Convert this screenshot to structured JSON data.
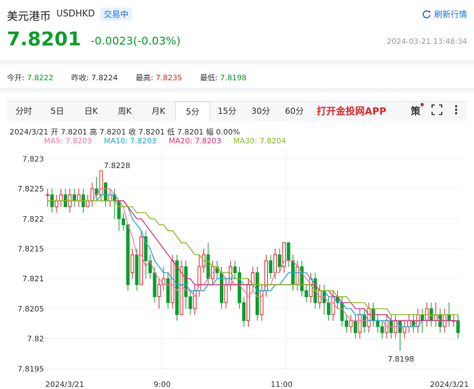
{
  "header": {
    "title": "美元港币",
    "code": "USDHKD",
    "status": "交易中",
    "refresh_label": "刷新行情",
    "price": "7.8201",
    "change": "-0.0023(-0.03%)",
    "timestamp": "2024-03-21 13:48:34"
  },
  "stats": [
    {
      "label": "今开:",
      "value": "7.8222",
      "color": "green"
    },
    {
      "label": "昨收:",
      "value": "7.8224",
      "color": "black"
    },
    {
      "label": "最高:",
      "value": "7.8235",
      "color": "red"
    },
    {
      "label": "最低:",
      "value": "7.8198",
      "color": "green"
    }
  ],
  "tabs": [
    {
      "label": "分时",
      "active": false
    },
    {
      "label": "5日",
      "active": false
    },
    {
      "label": "日K",
      "active": false
    },
    {
      "label": "周K",
      "active": false
    },
    {
      "label": "月K",
      "active": false
    },
    {
      "label": "5分",
      "active": true
    },
    {
      "label": "15分",
      "active": false
    },
    {
      "label": "30分",
      "active": false
    },
    {
      "label": "60分",
      "active": false
    }
  ],
  "toolbar": {
    "app_link": "打开金投网APP",
    "strategy_label": "策"
  },
  "info_line": "2024/3/21  开 7.8201  高 7.8201  收 7.8201  低 7.8201  幅 0.00%",
  "ma_legend": [
    {
      "label": "MA5: 7.8203",
      "color": "#f07aa3"
    },
    {
      "label": "MA10: 7.8203",
      "color": "#1fa9d6"
    },
    {
      "label": "MA20: 7.8203",
      "color": "#e0307a"
    },
    {
      "label": "MA30: 7.8204",
      "color": "#8ab820"
    }
  ],
  "chart_data": {
    "type": "candlestick",
    "x_ticks": [
      "2024/3/21",
      "9:00",
      "11:00",
      "2024/3/21"
    ],
    "y_ticks": [
      7.8195,
      7.82,
      7.8205,
      7.821,
      7.8215,
      7.822,
      7.8225,
      7.823
    ],
    "ylim": [
      7.8194,
      7.8232
    ],
    "annotations": [
      {
        "text": "7.8228",
        "value": 7.8228,
        "at_index": 12
      },
      {
        "text": "7.8198",
        "value": 7.8198,
        "at_index": 79
      }
    ],
    "up_color": "#e0262b",
    "down_color": "#0a9e2c",
    "candles": [
      [
        7.8224,
        7.8224,
        7.8225,
        7.8222
      ],
      [
        7.8224,
        7.8222,
        7.8225,
        7.8221
      ],
      [
        7.8222,
        7.8223,
        7.8224,
        7.8221
      ],
      [
        7.8223,
        7.8224,
        7.8225,
        7.8222
      ],
      [
        7.8224,
        7.8222,
        7.8225,
        7.8222
      ],
      [
        7.8222,
        7.8224,
        7.8225,
        7.8221
      ],
      [
        7.8224,
        7.8223,
        7.8225,
        7.8222
      ],
      [
        7.8223,
        7.8224,
        7.8225,
        7.8222
      ],
      [
        7.8224,
        7.8222,
        7.8225,
        7.8221
      ],
      [
        7.8222,
        7.8223,
        7.8224,
        7.8222
      ],
      [
        7.8223,
        7.8225,
        7.8226,
        7.8222
      ],
      [
        7.8225,
        7.8224,
        7.8227,
        7.8223
      ],
      [
        7.8224,
        7.8228,
        7.8228,
        7.8223
      ],
      [
        7.8226,
        7.8223,
        7.8226,
        7.8222
      ],
      [
        7.8223,
        7.8224,
        7.8225,
        7.8222
      ],
      [
        7.8224,
        7.8223,
        7.8225,
        7.822
      ],
      [
        7.8223,
        7.822,
        7.8223,
        7.8218
      ],
      [
        7.822,
        7.8219,
        7.8221,
        7.8218
      ],
      [
        7.8219,
        7.8209,
        7.8219,
        7.8208
      ],
      [
        7.8211,
        7.8214,
        7.8215,
        7.821
      ],
      [
        7.8214,
        7.8209,
        7.8215,
        7.8208
      ],
      [
        7.8209,
        7.8217,
        7.8218,
        7.8209
      ],
      [
        7.8217,
        7.8213,
        7.8218,
        7.821
      ],
      [
        7.8213,
        7.8211,
        7.8214,
        7.821
      ],
      [
        7.8211,
        7.8207,
        7.8212,
        7.8206
      ],
      [
        7.8207,
        7.8209,
        7.821,
        7.8205
      ],
      [
        7.8209,
        7.821,
        7.8212,
        7.8208
      ],
      [
        7.821,
        7.8206,
        7.8211,
        7.8205
      ],
      [
        7.8206,
        7.8213,
        7.8214,
        7.8205
      ],
      [
        7.8213,
        7.8204,
        7.8214,
        7.8203
      ],
      [
        7.8204,
        7.8212,
        7.8213,
        7.8204
      ],
      [
        7.8212,
        7.8207,
        7.8213,
        7.8205
      ],
      [
        7.8207,
        7.8205,
        7.8208,
        7.8204
      ],
      [
        7.8205,
        7.8208,
        7.8209,
        7.8204
      ],
      [
        7.8208,
        7.8212,
        7.8214,
        7.8207
      ],
      [
        7.8212,
        7.8214,
        7.8215,
        7.8211
      ],
      [
        7.8214,
        7.821,
        7.8216,
        7.8209
      ],
      [
        7.821,
        7.8212,
        7.8213,
        7.8209
      ],
      [
        7.8212,
        7.8211,
        7.8213,
        7.821
      ],
      [
        7.8211,
        7.8206,
        7.8212,
        7.8205
      ],
      [
        7.8206,
        7.8209,
        7.821,
        7.8205
      ],
      [
        7.8209,
        7.8212,
        7.8213,
        7.8208
      ],
      [
        7.8212,
        7.8211,
        7.8213,
        7.821
      ],
      [
        7.8211,
        7.8206,
        7.8212,
        7.8205
      ],
      [
        7.8206,
        7.8203,
        7.8207,
        7.8202
      ],
      [
        7.8203,
        7.8209,
        7.821,
        7.8202
      ],
      [
        7.8209,
        7.8211,
        7.8212,
        7.8208
      ],
      [
        7.8211,
        7.8204,
        7.8212,
        7.8203
      ],
      [
        7.8204,
        7.8208,
        7.8209,
        7.8203
      ],
      [
        7.8208,
        7.8213,
        7.8214,
        7.8207
      ],
      [
        7.8213,
        7.8211,
        7.8214,
        7.821
      ],
      [
        7.8211,
        7.8214,
        7.8215,
        7.821
      ],
      [
        7.8214,
        7.8212,
        7.8215,
        7.8211
      ],
      [
        7.8212,
        7.8216,
        7.8216,
        7.8211
      ],
      [
        7.8216,
        7.8213,
        7.8216,
        7.8212
      ],
      [
        7.8213,
        7.8209,
        7.8214,
        7.8208
      ],
      [
        7.8209,
        7.8212,
        7.8213,
        7.8208
      ],
      [
        7.8212,
        7.8208,
        7.8213,
        7.8207
      ],
      [
        7.8208,
        7.8207,
        7.8209,
        7.8206
      ],
      [
        7.8207,
        7.821,
        7.8211,
        7.8206
      ],
      [
        7.821,
        7.8206,
        7.8211,
        7.8205
      ],
      [
        7.8206,
        7.8208,
        7.8209,
        7.8205
      ],
      [
        7.8208,
        7.8206,
        7.8209,
        7.8204
      ],
      [
        7.8206,
        7.8204,
        7.8207,
        7.8203
      ],
      [
        7.8204,
        7.8207,
        7.8208,
        7.8203
      ],
      [
        7.8207,
        7.8206,
        7.8208,
        7.8205
      ],
      [
        7.8206,
        7.8203,
        7.8207,
        7.8202
      ],
      [
        7.8203,
        7.8202,
        7.8204,
        7.8201
      ],
      [
        7.8202,
        7.8203,
        7.8204,
        7.8201
      ],
      [
        7.8203,
        7.8201,
        7.8204,
        7.82
      ],
      [
        7.8201,
        7.8204,
        7.8205,
        7.82
      ],
      [
        7.8204,
        7.8202,
        7.8205,
        7.8201
      ],
      [
        7.8202,
        7.8205,
        7.8206,
        7.8201
      ],
      [
        7.8205,
        7.8203,
        7.8206,
        7.8202
      ],
      [
        7.8203,
        7.8202,
        7.8204,
        7.8201
      ],
      [
        7.8202,
        7.8201,
        7.8203,
        7.82
      ],
      [
        7.8201,
        7.8203,
        7.8204,
        7.82
      ],
      [
        7.8203,
        7.8201,
        7.8204,
        7.82
      ],
      [
        7.8201,
        7.8203,
        7.8204,
        7.82
      ],
      [
        7.8203,
        7.8201,
        7.8203,
        7.8198
      ],
      [
        7.8201,
        7.8202,
        7.8203,
        7.82
      ],
      [
        7.8202,
        7.8203,
        7.8204,
        7.8201
      ],
      [
        7.8203,
        7.8202,
        7.8204,
        7.8201
      ],
      [
        7.8202,
        7.8204,
        7.8205,
        7.8201
      ],
      [
        7.8204,
        7.8203,
        7.8205,
        7.8201
      ],
      [
        7.8203,
        7.8205,
        7.8206,
        7.8202
      ],
      [
        7.8205,
        7.8203,
        7.8206,
        7.8202
      ],
      [
        7.8203,
        7.8204,
        7.8206,
        7.8202
      ],
      [
        7.8204,
        7.8202,
        7.8205,
        7.8201
      ],
      [
        7.8202,
        7.8204,
        7.8205,
        7.8201
      ],
      [
        7.8204,
        7.8203,
        7.8206,
        7.8202
      ],
      [
        7.8203,
        7.8203,
        7.8204,
        7.8202
      ],
      [
        7.8203,
        7.8201,
        7.8204,
        7.82
      ]
    ],
    "ma": {
      "MA5": [
        7.8223,
        7.8223,
        7.8223,
        7.8223,
        7.8223,
        7.8223,
        7.8223,
        7.8223,
        7.8223,
        7.8223,
        7.8223,
        7.8224,
        7.8225,
        7.8225,
        7.8225,
        7.8224,
        7.8223,
        7.8222,
        7.8219,
        7.8217,
        7.8214,
        7.8214,
        7.8212,
        7.8213,
        7.8211,
        7.821,
        7.8209,
        7.8209,
        7.8209,
        7.8208,
        7.8209,
        7.8208,
        7.8208,
        7.8207,
        7.8209,
        7.8209,
        7.821,
        7.8211,
        7.8212,
        7.8211,
        7.821,
        7.821,
        7.8209,
        7.8209,
        7.8208,
        7.8207,
        7.8208,
        7.8207,
        7.8207,
        7.8209,
        7.8209,
        7.8211,
        7.8211,
        7.8213,
        7.8213,
        7.8213,
        7.8212,
        7.8211,
        7.821,
        7.8209,
        7.8208,
        7.8207,
        7.8207,
        7.8206,
        7.8206,
        7.8205,
        7.8205,
        7.8204,
        7.8203,
        7.8203,
        7.8203,
        7.8203,
        7.8203,
        7.8203,
        7.8203,
        7.8203,
        7.8202,
        7.8202,
        7.8202,
        7.8202,
        7.8202,
        7.8202,
        7.8202,
        7.8203,
        7.8203,
        7.8203,
        7.8204,
        7.8204,
        7.8203,
        7.8203,
        7.8203,
        7.8203,
        7.8203
      ],
      "MA10": [
        7.8223,
        7.8223,
        7.8223,
        7.8223,
        7.8223,
        7.8223,
        7.8223,
        7.8223,
        7.8223,
        7.8223,
        7.8223,
        7.8223,
        7.8224,
        7.8224,
        7.8224,
        7.8224,
        7.8223,
        7.8223,
        7.8222,
        7.822,
        7.8219,
        7.8218,
        7.8216,
        7.8215,
        7.8213,
        7.8212,
        7.8211,
        7.8211,
        7.821,
        7.8209,
        7.8209,
        7.8209,
        7.8208,
        7.8208,
        7.8208,
        7.8208,
        7.8209,
        7.8209,
        7.821,
        7.821,
        7.821,
        7.821,
        7.821,
        7.821,
        7.8209,
        7.8209,
        7.8209,
        7.8208,
        7.8208,
        7.8208,
        7.8208,
        7.8209,
        7.8209,
        7.821,
        7.8211,
        7.8211,
        7.8211,
        7.8211,
        7.8211,
        7.821,
        7.8209,
        7.8208,
        7.8208,
        7.8207,
        7.8207,
        7.8206,
        7.8206,
        7.8205,
        7.8205,
        7.8204,
        7.8204,
        7.8204,
        7.8203,
        7.8203,
        7.8203,
        7.8203,
        7.8203,
        7.8203,
        7.8203,
        7.8202,
        7.8202,
        7.8202,
        7.8202,
        7.8202,
        7.8203,
        7.8203,
        7.8203,
        7.8203,
        7.8203,
        7.8203,
        7.8203,
        7.8203,
        7.8203
      ],
      "MA20": [
        7.8223,
        7.8223,
        7.8223,
        7.8223,
        7.8223,
        7.8223,
        7.8223,
        7.8223,
        7.8223,
        7.8223,
        7.8223,
        7.8223,
        7.8223,
        7.8223,
        7.8223,
        7.8223,
        7.8223,
        7.8223,
        7.8222,
        7.8221,
        7.822,
        7.822,
        7.8219,
        7.8218,
        7.8217,
        7.8216,
        7.8215,
        7.8214,
        7.8213,
        7.8212,
        7.8211,
        7.821,
        7.821,
        7.8209,
        7.8209,
        7.8209,
        7.8209,
        7.8209,
        7.8209,
        7.8209,
        7.8209,
        7.8209,
        7.8209,
        7.8209,
        7.8209,
        7.8209,
        7.8209,
        7.8209,
        7.8209,
        7.8209,
        7.8209,
        7.8209,
        7.8209,
        7.8209,
        7.8209,
        7.8209,
        7.8209,
        7.8209,
        7.8209,
        7.8209,
        7.8209,
        7.8208,
        7.8208,
        7.8208,
        7.8207,
        7.8207,
        7.8206,
        7.8206,
        7.8206,
        7.8205,
        7.8205,
        7.8205,
        7.8204,
        7.8204,
        7.8204,
        7.8204,
        7.8204,
        7.8203,
        7.8203,
        7.8203,
        7.8203,
        7.8203,
        7.8203,
        7.8203,
        7.8203,
        7.8203,
        7.8203,
        7.8203,
        7.8203,
        7.8203,
        7.8203,
        7.8203,
        7.8203
      ],
      "MA30": [
        7.8223,
        7.8223,
        7.8223,
        7.8223,
        7.8223,
        7.8223,
        7.8223,
        7.8223,
        7.8223,
        7.8223,
        7.8223,
        7.8223,
        7.8223,
        7.8223,
        7.8223,
        7.8223,
        7.8222,
        7.8222,
        7.8222,
        7.8222,
        7.8221,
        7.8221,
        7.8221,
        7.822,
        7.822,
        7.8219,
        7.8219,
        7.8218,
        7.8218,
        7.8217,
        7.8216,
        7.8216,
        7.8215,
        7.8214,
        7.8214,
        7.8213,
        7.8213,
        7.8212,
        7.8212,
        7.8211,
        7.8211,
        7.8211,
        7.821,
        7.821,
        7.821,
        7.821,
        7.8209,
        7.8209,
        7.8209,
        7.8209,
        7.8209,
        7.8209,
        7.8209,
        7.8209,
        7.8209,
        7.8209,
        7.8209,
        7.8209,
        7.8209,
        7.8209,
        7.8208,
        7.8208,
        7.8208,
        7.8208,
        7.8208,
        7.8207,
        7.8207,
        7.8207,
        7.8206,
        7.8206,
        7.8206,
        7.8206,
        7.8205,
        7.8205,
        7.8205,
        7.8205,
        7.8205,
        7.8204,
        7.8204,
        7.8204,
        7.8204,
        7.8204,
        7.8204,
        7.8204,
        7.8204,
        7.8204,
        7.8204,
        7.8204,
        7.8204,
        7.8204,
        7.8204,
        7.8204,
        7.8204
      ]
    }
  }
}
